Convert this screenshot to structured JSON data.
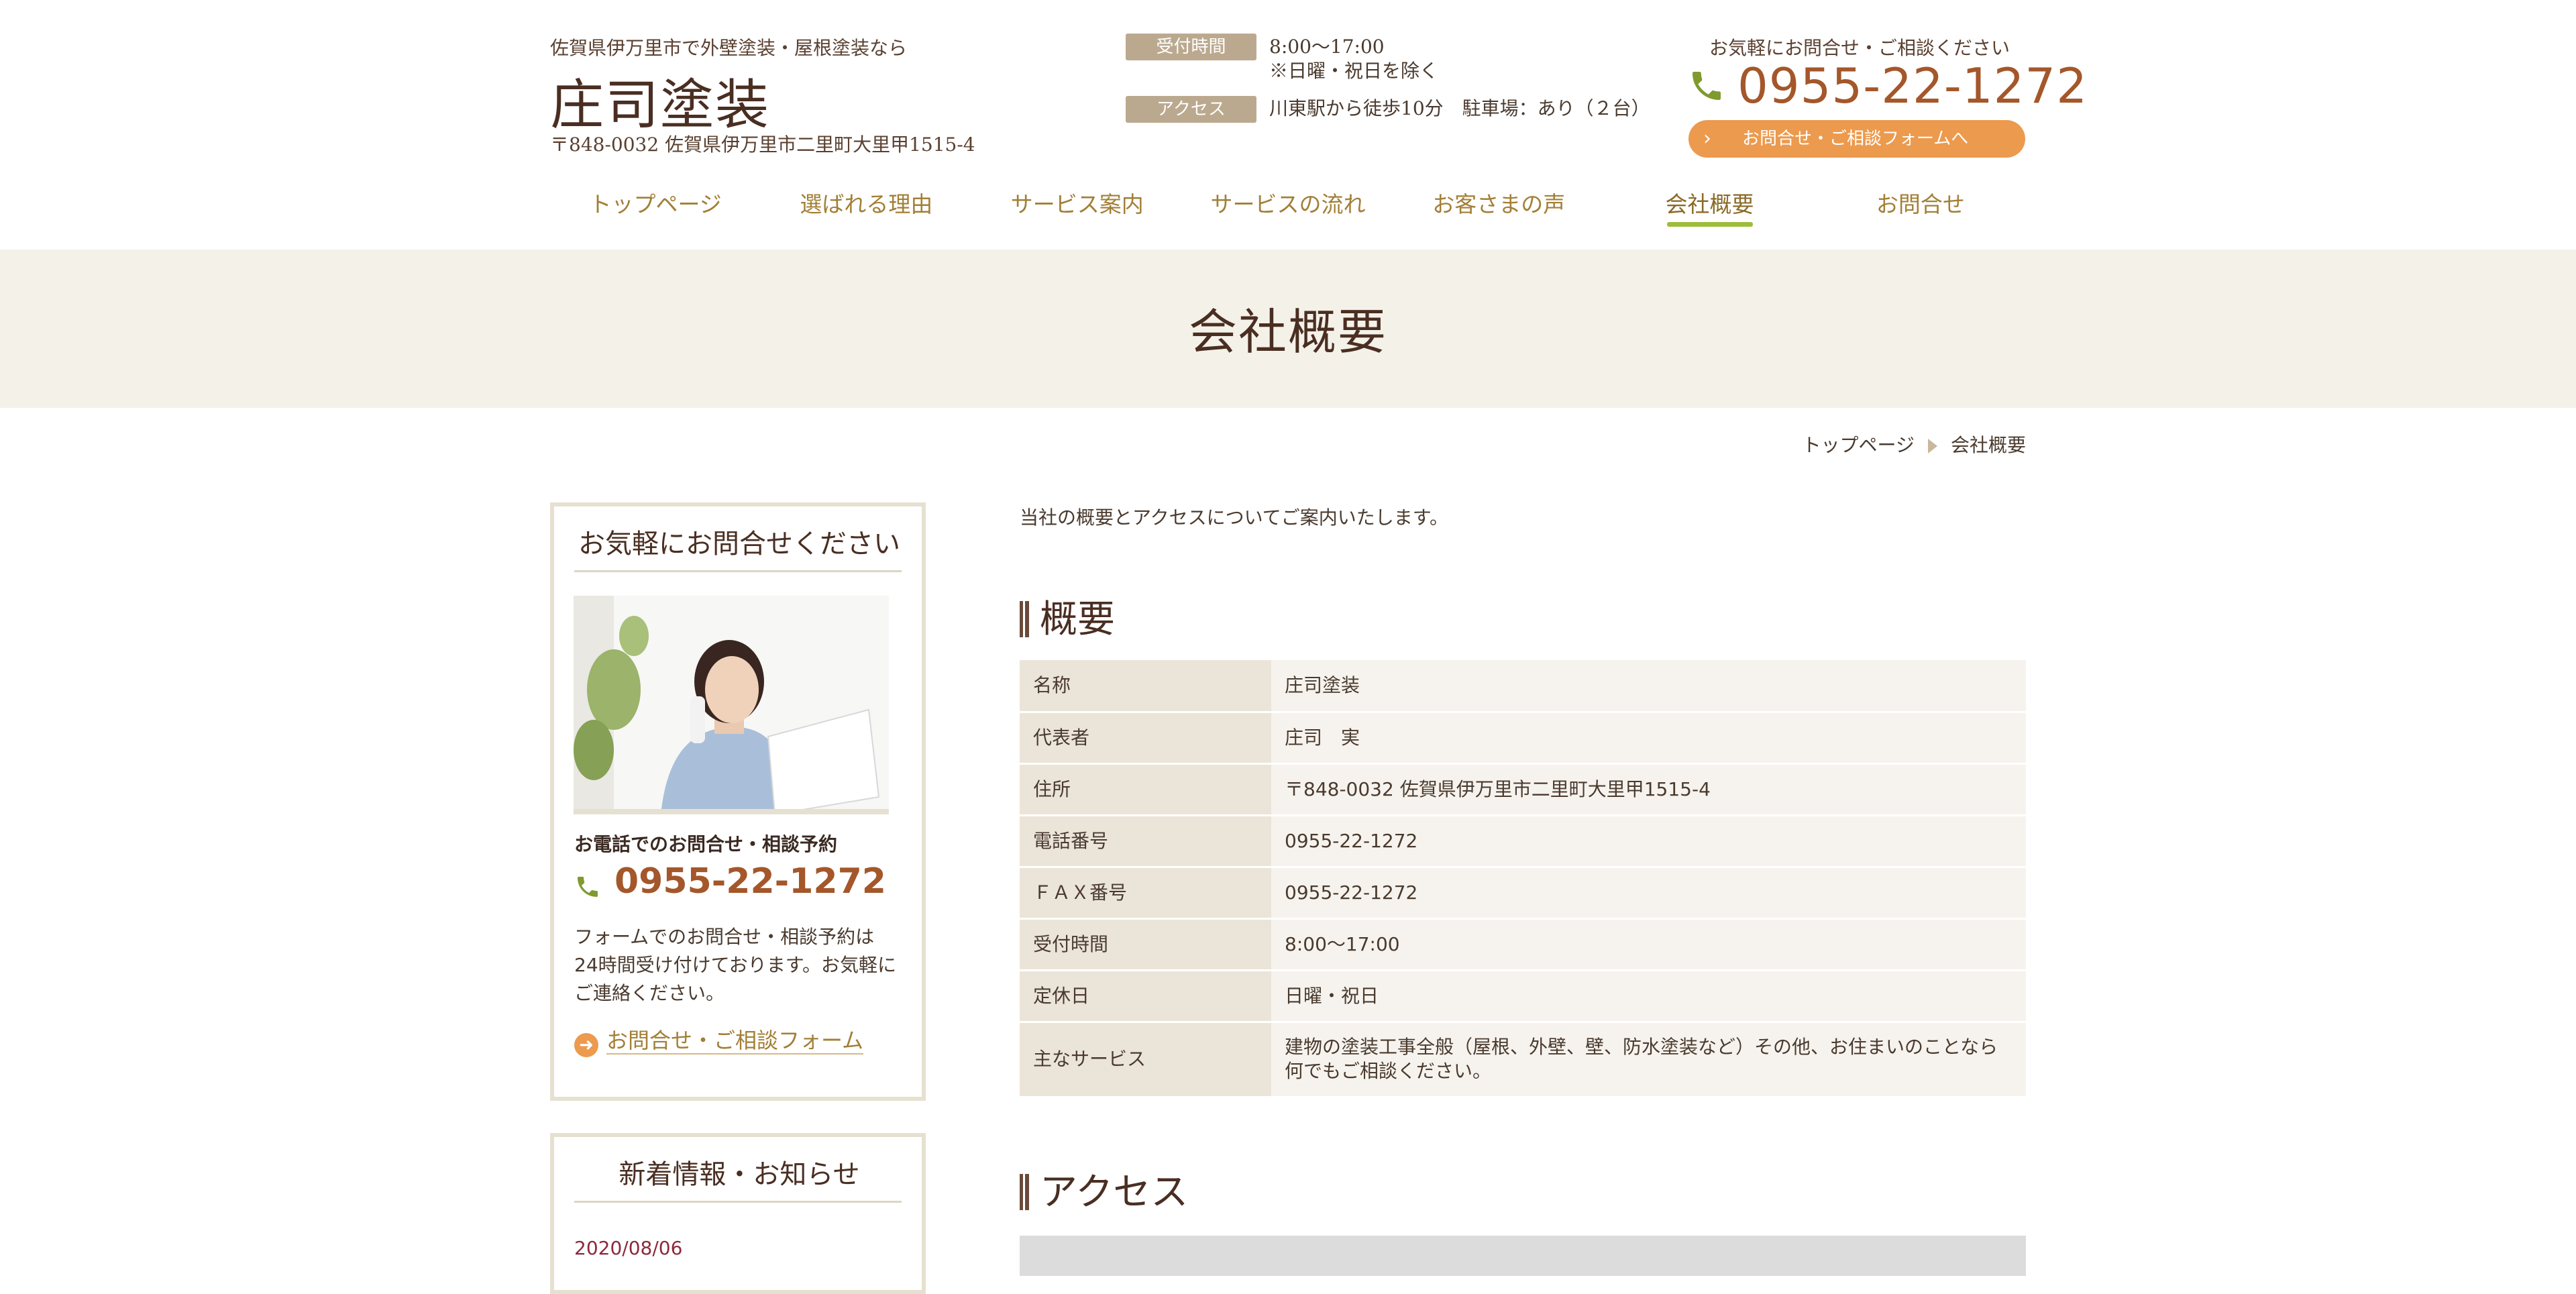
{
  "header": {
    "tagline": "佐賀県伊万里市で外壁塗装・屋根塗装なら",
    "logo": "庄司塗装",
    "address": "〒848-0032 佐賀県伊万里市二里町大里甲1515-4",
    "hours_label": "受付時間",
    "hours_line1": "8:00～17:00",
    "hours_line2": "※日曜・祝日を除く",
    "access_label": "アクセス",
    "access_text": "川東駅から徒歩10分　駐車場：あり（２台）",
    "contact_caption": "お気軽にお問合せ・ご相談ください",
    "phone": "0955-22-1272",
    "form_button": "お問合せ・ご相談フォームへ",
    "phone_icon": "phone-icon",
    "accent_color": "#ec9a4e"
  },
  "nav": {
    "items": [
      {
        "label": "トップページ"
      },
      {
        "label": "選ばれる理由"
      },
      {
        "label": "サービス案内"
      },
      {
        "label": "サービスの流れ"
      },
      {
        "label": "お客さまの声"
      },
      {
        "label": "会社概要"
      },
      {
        "label": "お問合せ"
      }
    ],
    "active_label": "会社概要",
    "active_color": "#9dbd3b"
  },
  "hero": {
    "title": "会社概要"
  },
  "breadcrumb": {
    "home": "トップページ",
    "current": "会社概要"
  },
  "sidebar": {
    "contact_title": "お気軽にお問合せください",
    "phone_label": "お電話でのお問合せ・相談予約",
    "phone": "0955-22-1272",
    "description": "フォームでのお問合せ・相談予約は24時間受け付けております。お気軽にご連絡ください。",
    "form_link": "お問合せ・ご相談フォーム",
    "news_title": "新着情報・お知らせ",
    "news_date": "2020/08/06"
  },
  "main": {
    "intro": "当社の概要とアクセスについてご案内いたします。",
    "overview_heading": "概要",
    "access_heading": "アクセス",
    "table": [
      {
        "key": "名称",
        "value": "庄司塗装"
      },
      {
        "key": "代表者",
        "value": "庄司　実"
      },
      {
        "key": "住所",
        "value": "〒848-0032 佐賀県伊万里市二里町大里甲1515-4"
      },
      {
        "key": "電話番号",
        "value": "0955-22-1272"
      },
      {
        "key": "ＦＡＸ番号",
        "value": "0955-22-1272"
      },
      {
        "key": "受付時間",
        "value": "8:00～17:00"
      },
      {
        "key": "定休日",
        "value": "日曜・祝日"
      },
      {
        "key": "主なサービス",
        "value": "建物の塗装工事全般（屋根、外壁、壁、防水塗装など）その他、お住まいのことなら何でもご相談ください。"
      }
    ]
  }
}
